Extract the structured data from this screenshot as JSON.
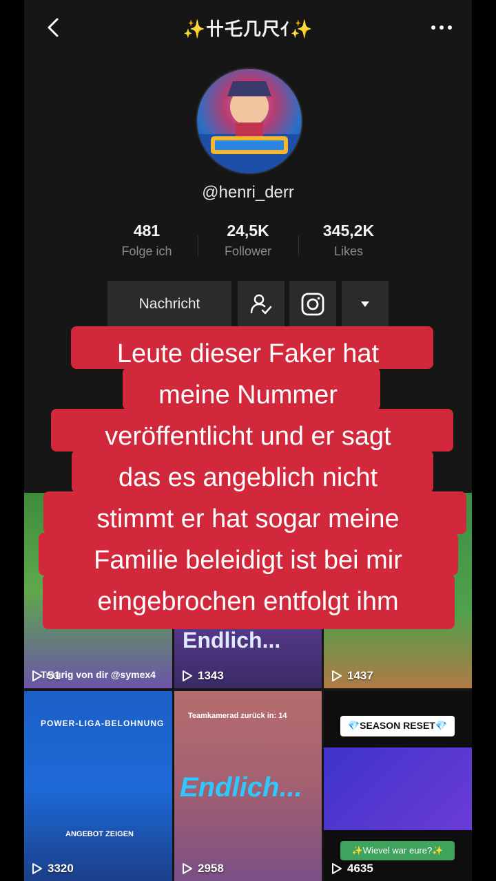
{
  "header": {
    "title": "✨卄乇几尺ｲ✨"
  },
  "profile": {
    "handle": "@henri_derr",
    "stats": [
      {
        "value": "481",
        "label": "Folge ich"
      },
      {
        "value": "24,5K",
        "label": "Follower"
      },
      {
        "value": "345,2K",
        "label": "Likes"
      }
    ],
    "message_button": "Nachricht"
  },
  "caption": {
    "lines": [
      "Leute dieser Faker hat",
      "meine Nummer",
      "veröffentlicht und er sagt",
      "das es angeblich nicht",
      "stimmt er hat sogar meine",
      "Familie beleidigt ist bei mir",
      "eingebrochen entfolgt ihm"
    ]
  },
  "videos": [
    {
      "views": "51",
      "overlay": "Traurig von dir @symex4"
    },
    {
      "views": "1343",
      "overlay": "Endlich..."
    },
    {
      "views": "1437",
      "overlay": ""
    },
    {
      "views": "3320",
      "overlay": "POWER-LIGA-BELOHNUNG",
      "sub": "ANGEBOT ZEIGEN"
    },
    {
      "views": "2958",
      "overlay": "Endlich...",
      "sub": "Teamkamerad zurück in: 14"
    },
    {
      "views": "4635",
      "overlay": "💎SEASON RESET💎",
      "sub": "✨Wievel war eure?✨"
    }
  ],
  "colors": {
    "caption_bg": "#d2283c",
    "panel_bg": "#161616"
  }
}
